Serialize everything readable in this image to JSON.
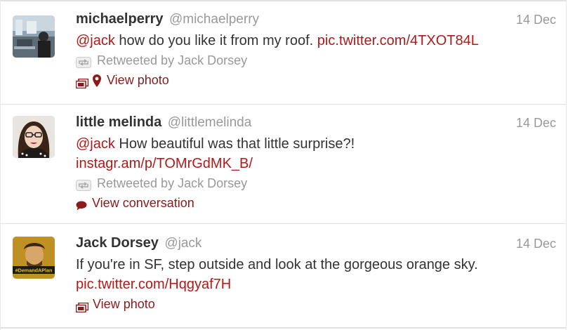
{
  "colors": {
    "link": "#b01a1a",
    "action": "#8b1a1a",
    "muted": "#999999",
    "text": "#333333"
  },
  "tweets": [
    {
      "fullname": "michaelperry",
      "username": "@michaelperry",
      "time": "14 Dec",
      "mention": "@jack",
      "text_rest": " how do you like it from my roof. ",
      "link": "pic.twitter.com/4TXOT84L",
      "retweet": "Retweeted by Jack Dorsey",
      "action": "View photo"
    },
    {
      "fullname": "little melinda",
      "username": "@littlemelinda",
      "time": "14 Dec",
      "mention": "@jack",
      "text_rest": " How beautiful was that little surprise?!",
      "link": "instagr.am/p/TOMrGdMK_B/",
      "retweet": "Retweeted by Jack Dorsey",
      "action": "View conversation"
    },
    {
      "fullname": "Jack Dorsey",
      "username": "@jack",
      "time": "14 Dec",
      "text": "If you're in SF, step outside and look at the gorgeous orange sky.",
      "link": "pic.twitter.com/Hqgyaf7H",
      "action": "View photo",
      "avatar_banner": "#DemandAPlan"
    }
  ]
}
